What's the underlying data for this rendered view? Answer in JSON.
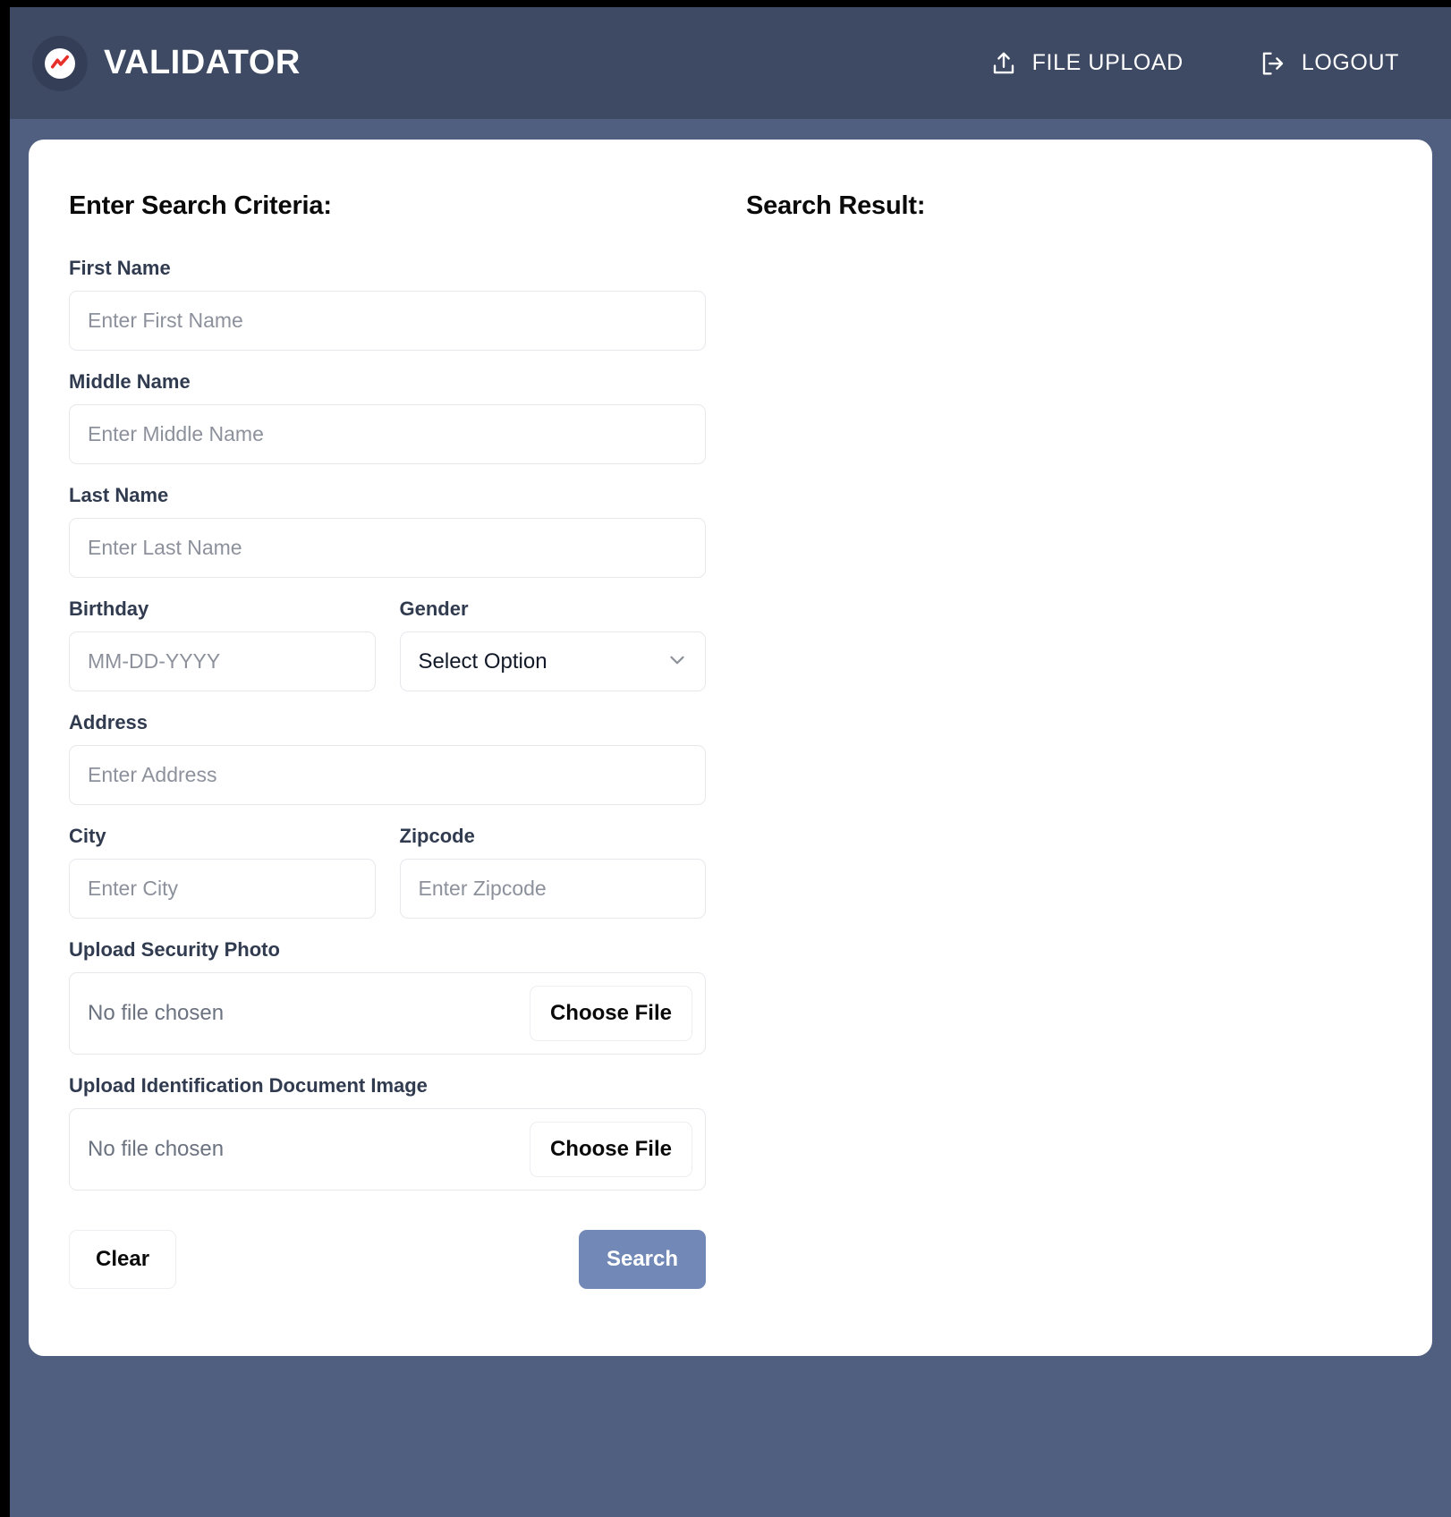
{
  "header": {
    "brand_name": "VALIDATOR",
    "logo_icon": "chart-spark-logo-icon",
    "file_upload_label": "FILE UPLOAD",
    "file_upload_icon": "upload-icon",
    "logout_label": "LOGOUT",
    "logout_icon": "logout-icon",
    "background_color": "#3e4a63"
  },
  "page": {
    "background_color": "#505f80",
    "card_background": "#ffffff"
  },
  "search_form": {
    "title": "Enter Search Criteria:",
    "fields": {
      "first_name": {
        "label": "First Name",
        "placeholder": "Enter First Name",
        "value": ""
      },
      "middle_name": {
        "label": "Middle Name",
        "placeholder": "Enter Middle Name",
        "value": ""
      },
      "last_name": {
        "label": "Last Name",
        "placeholder": "Enter Last Name",
        "value": ""
      },
      "birthday": {
        "label": "Birthday",
        "placeholder": "MM-DD-YYYY",
        "value": ""
      },
      "gender": {
        "label": "Gender",
        "selected": "Select Option",
        "chevron_icon": "chevron-down-icon"
      },
      "address": {
        "label": "Address",
        "placeholder": "Enter Address",
        "value": ""
      },
      "city": {
        "label": "City",
        "placeholder": "Enter City",
        "value": ""
      },
      "zipcode": {
        "label": "Zipcode",
        "placeholder": "Enter Zipcode",
        "value": ""
      },
      "security_photo": {
        "label": "Upload Security Photo",
        "status": "No file chosen",
        "button": "Choose File"
      },
      "identification_document": {
        "label": "Upload Identification Document Image",
        "status": "No file chosen",
        "button": "Choose File"
      }
    },
    "buttons": {
      "clear": "Clear",
      "search": "Search",
      "search_color": "#7289b8"
    }
  },
  "search_result": {
    "title": "Search Result:",
    "content": ""
  }
}
